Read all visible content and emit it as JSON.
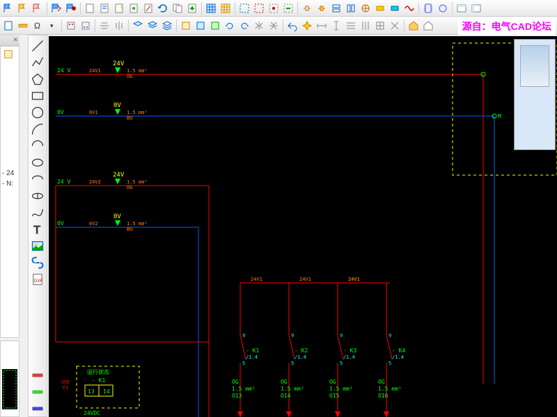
{
  "watermark": "源自：电气CAD论坛",
  "tree": {
    "item1": "- 24",
    "item2": "- N:"
  },
  "panel_close": "✕",
  "rails": {
    "v24_1": {
      "label": "24V",
      "tag": "24V1",
      "wire": "1.5 mm²",
      "color": "OG",
      "net": "24 V"
    },
    "v0_1": {
      "label": "0V",
      "tag": "0V1",
      "wire": "1.5 mm²",
      "color": "BU",
      "net": "0V"
    },
    "v24_2": {
      "label": "24V",
      "tag": "24V2",
      "wire": "1.5 mm²",
      "color": "OG",
      "net": "24 V"
    },
    "v0_2": {
      "label": "0V",
      "tag": "0V2",
      "wire": "1.5 mm²",
      "color": "BU",
      "net": "0V"
    }
  },
  "relay_box": {
    "status": "运行状态",
    "name": "- K1",
    "err": "009",
    "pin1": "13",
    "pin2": "14",
    "supply": "24VDC"
  },
  "contacts": [
    {
      "tap": "24V1",
      "name": "- K1",
      "ref": "/1.4",
      "t1": "9",
      "t2": "5",
      "wc": "OG",
      "ws": "1.5 mm²",
      "out": "O13"
    },
    {
      "tap": "24V1",
      "name": "- K2",
      "ref": "/1.4",
      "t1": "9",
      "t2": "5",
      "wc": "OG",
      "ws": "1.5 mm²",
      "out": "O14"
    },
    {
      "tap": "24V1",
      "name": "- K3",
      "ref": "/1.4",
      "t1": "9",
      "t2": "5",
      "wc": "OG",
      "ws": "1.5 mm²",
      "out": "O15"
    },
    {
      "tap": "24V1",
      "name": "- K4",
      "ref": "/1.4",
      "t1": "9",
      "t2": "5",
      "wc": "OG",
      "ws": "1.5 mm²",
      "out": "O16"
    }
  ],
  "node_m": "M",
  "xref": "-F1"
}
